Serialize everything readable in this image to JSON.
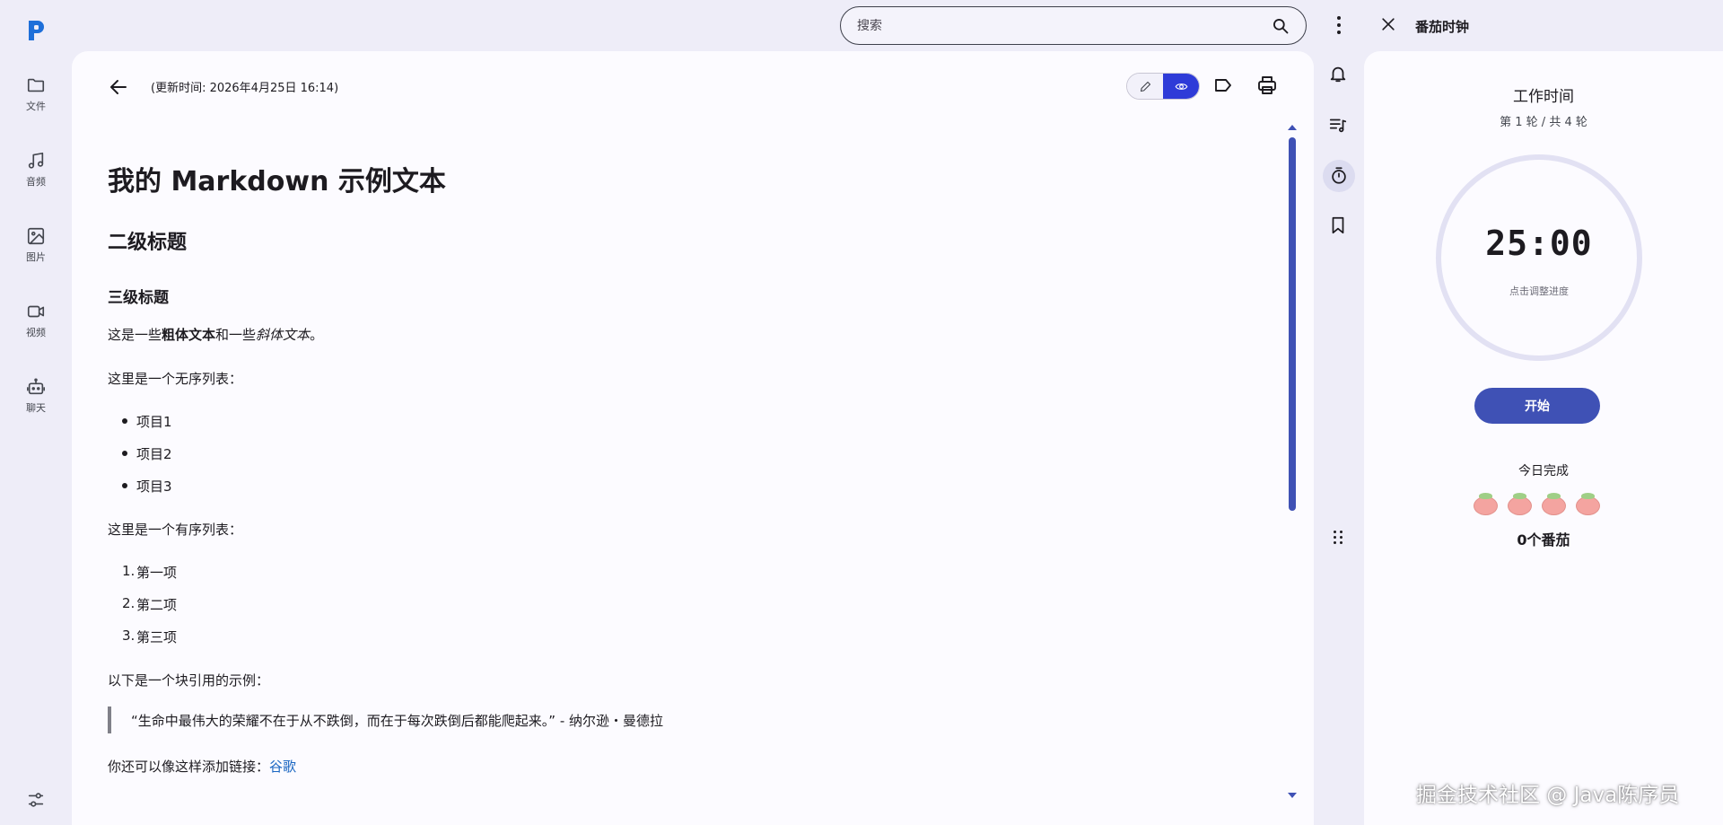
{
  "rail": {
    "items": [
      {
        "label": "文件",
        "icon": "folder-icon"
      },
      {
        "label": "音频",
        "icon": "music-note-icon"
      },
      {
        "label": "图片",
        "icon": "image-icon"
      },
      {
        "label": "视频",
        "icon": "video-icon"
      },
      {
        "label": "聊天",
        "icon": "robot-icon"
      }
    ]
  },
  "search": {
    "placeholder": "搜索"
  },
  "editor": {
    "updated": "(更新时间: 2026年4月25日 16:14)"
  },
  "doc": {
    "h1": "我的 Markdown 示例文本",
    "h2": "二级标题",
    "h3": "三级标题",
    "para1": {
      "pre": "这是一些",
      "bold": "粗体文本",
      "mid": "和一些",
      "italic": "斜体文本",
      "post": "。"
    },
    "ul_intro": "这里是一个无序列表：",
    "ul": [
      "项目1",
      "项目2",
      "项目3"
    ],
    "ol_intro": "这里是一个有序列表：",
    "ol": [
      {
        "n": "1.",
        "t": "第一项"
      },
      {
        "n": "2.",
        "t": "第二项"
      },
      {
        "n": "3.",
        "t": "第三项"
      }
    ],
    "quote_intro": "以下是一个块引用的示例：",
    "quote": "“生命中最伟大的荣耀不在于从不跌倒，而在于每次跌倒后都能爬起来。” - 纳尔逊・曼德拉",
    "link_pre": "你还可以像这样添加链接：",
    "link_text": "谷歌"
  },
  "pomodoro": {
    "title": "番茄时钟",
    "phase": "工作时间",
    "rounds": "第 1 轮 / 共 4 轮",
    "time": "25:00",
    "hint": "点击调整进度",
    "start": "开始",
    "today": "今日完成",
    "tomato_count": 4,
    "completed": "0个番茄"
  },
  "watermark": "掘金技术社区 @ Java陈序员",
  "colors": {
    "accent": "#3f51b5",
    "view_toggle": "#2e3bd8",
    "link": "#1a66c2"
  }
}
